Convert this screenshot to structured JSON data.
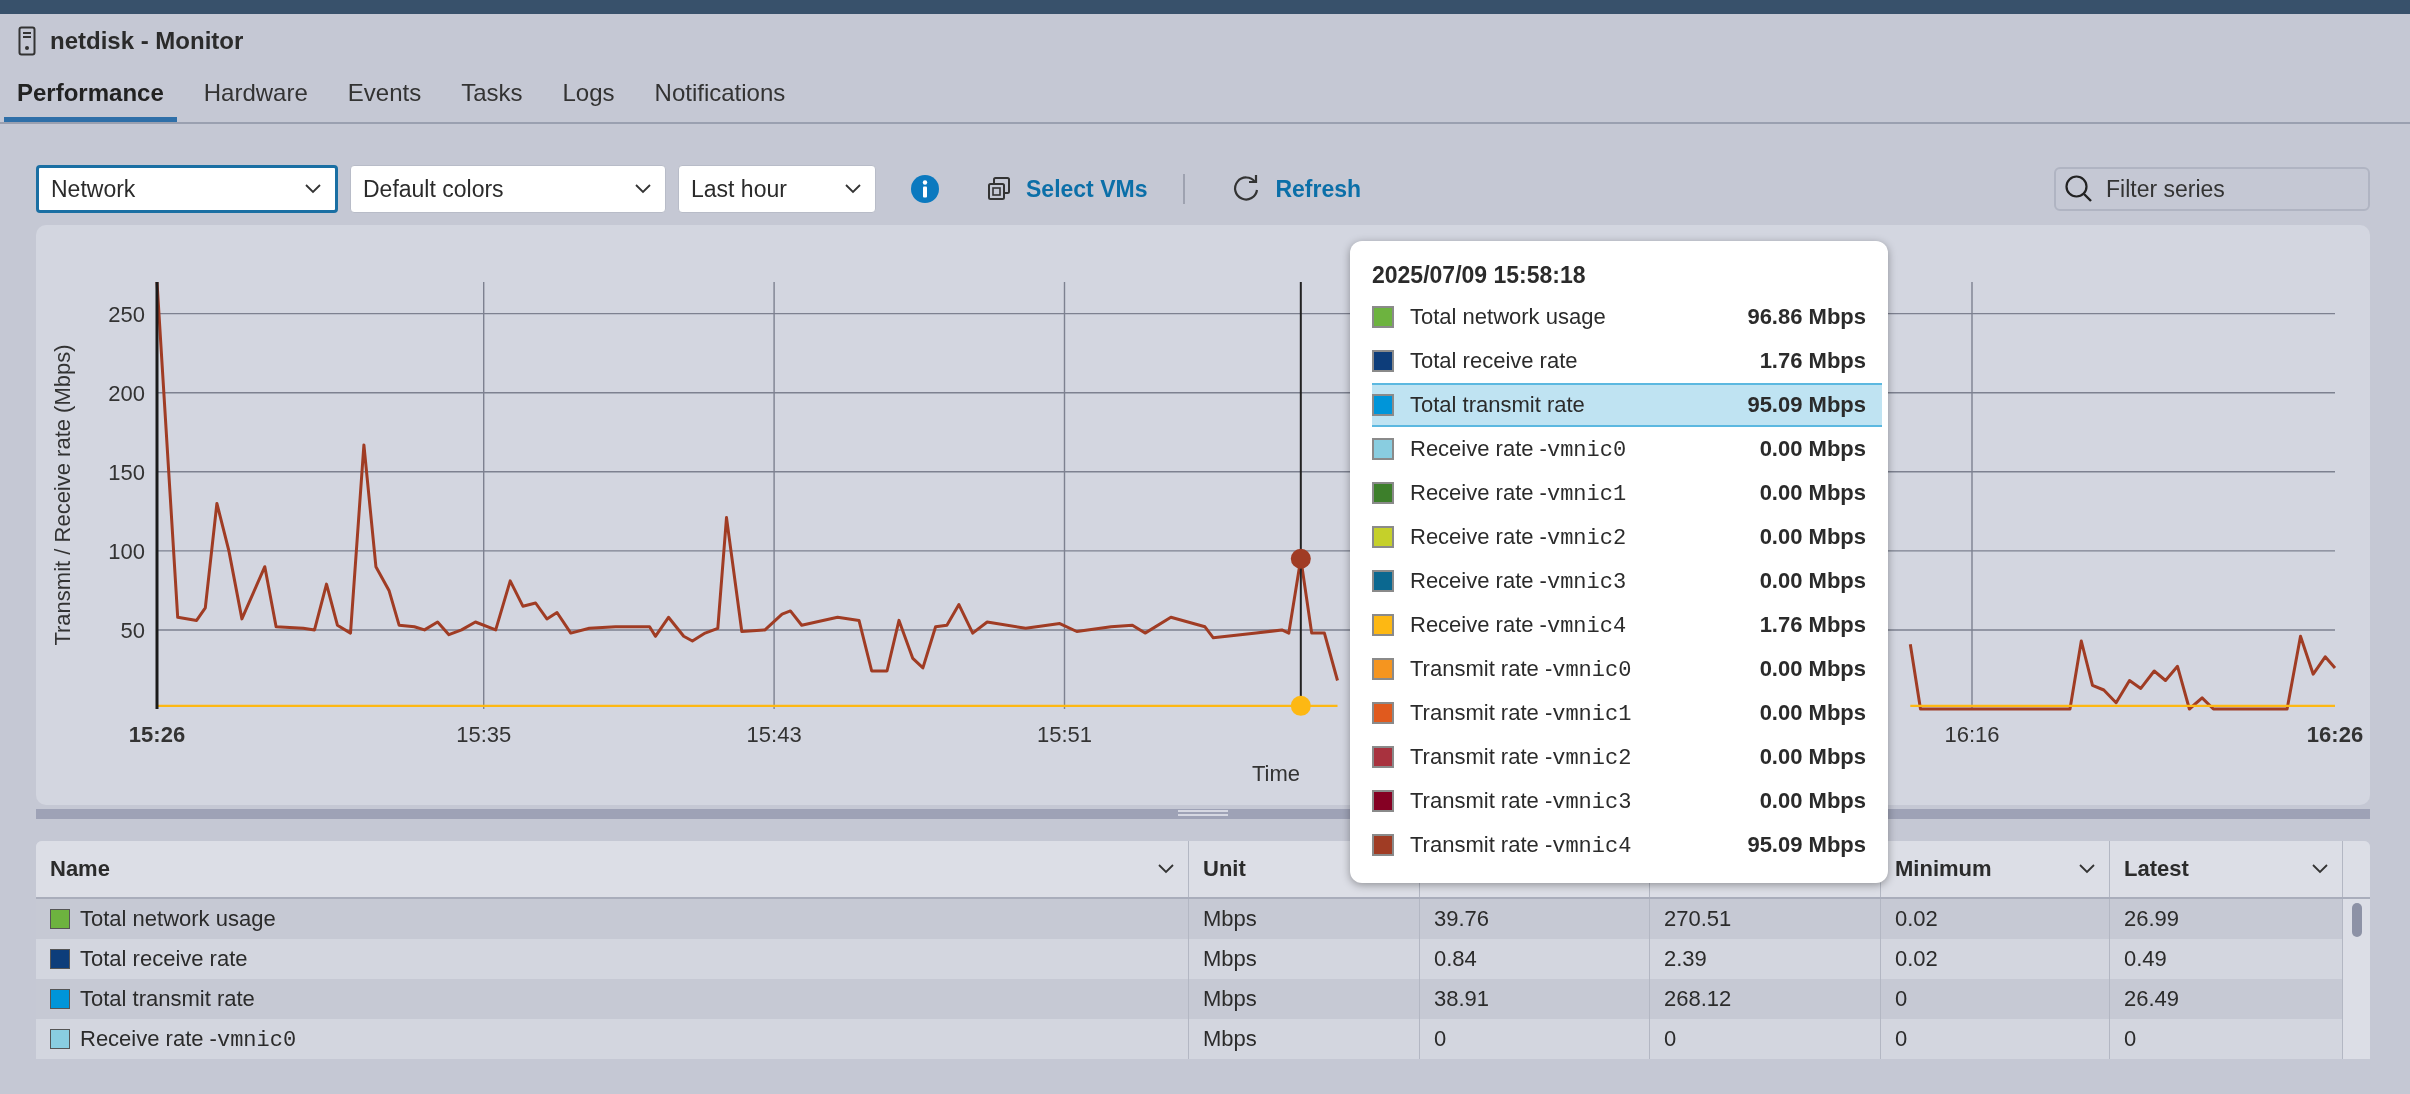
{
  "window": {
    "title": "netdisk - Monitor"
  },
  "tabs": [
    {
      "label": "Performance",
      "selected": true
    },
    {
      "label": "Hardware",
      "selected": false
    },
    {
      "label": "Events",
      "selected": false
    },
    {
      "label": "Tasks",
      "selected": false
    },
    {
      "label": "Logs",
      "selected": false
    },
    {
      "label": "Notifications",
      "selected": false
    }
  ],
  "toolbar": {
    "dropdowns": [
      {
        "value": "Network",
        "focused": true
      },
      {
        "value": "Default colors",
        "focused": false
      },
      {
        "value": "Last hour",
        "focused": false
      }
    ],
    "select_vms": "Select VMs",
    "refresh": "Refresh",
    "filter": {
      "placeholder": "Filter series"
    }
  },
  "chart": {
    "chart_data": {
      "type": "line",
      "xlabel": "Time",
      "ylabel": "Transmit / Receive rate (Mbps)",
      "xlim": [
        926,
        986
      ],
      "ylim": [
        0,
        270
      ],
      "grid": true,
      "yticks": [
        50,
        100,
        150,
        200,
        250
      ],
      "xticks": [
        {
          "value": 926,
          "label": "15:26"
        },
        {
          "value": 935,
          "label": "15:35"
        },
        {
          "value": 943,
          "label": "15:43"
        },
        {
          "value": 951,
          "label": "15:51"
        },
        {
          "value": 976,
          "label": "16:16"
        },
        {
          "value": 986,
          "label": "16:26"
        }
      ],
      "x": [
        926,
        926.57,
        927.09,
        927.33,
        927.65,
        927.98,
        928.34,
        928.97,
        929.28,
        930.03,
        930.34,
        930.67,
        930.97,
        931.33,
        931.7,
        932.03,
        932.39,
        932.67,
        933.09,
        933.37,
        933.73,
        934.04,
        934.39,
        934.77,
        935.33,
        935.73,
        936.08,
        936.43,
        936.74,
        937.02,
        937.4,
        937.91,
        938.63,
        939.57,
        939.73,
        940.09,
        940.51,
        940.75,
        941.1,
        941.45,
        941.69,
        942.11,
        942.75,
        943.22,
        943.45,
        943.76,
        944.16,
        944.75,
        945.34,
        945.69,
        946.11,
        946.44,
        946.82,
        947.1,
        947.45,
        947.76,
        948.09,
        948.47,
        948.87,
        949.93,
        950.87,
        951.34,
        952.28,
        952.87,
        953.22,
        953.93,
        954.87,
        955.1,
        956.28,
        956.99,
        957.18,
        957.51,
        957.81,
        958.16,
        958.52,
        966,
        974.3,
        974.58,
        975.99,
        978.7,
        979.01,
        979.32,
        979.63,
        979.97,
        980.34,
        980.65,
        981.02,
        981.33,
        981.66,
        981.99,
        982.34,
        982.65,
        984.68,
        985.05,
        985.4,
        985.73,
        986
      ],
      "series": [
        {
          "color": "#a03c24",
          "values": [
            270,
            58,
            56,
            64,
            130,
            100,
            57,
            90,
            52,
            51,
            50,
            79,
            53,
            48,
            167,
            90,
            75,
            53,
            52,
            50,
            55,
            47,
            50,
            55,
            50,
            81,
            65,
            67,
            57,
            61,
            48,
            51,
            52,
            52,
            46,
            58,
            46,
            43,
            48,
            51,
            121,
            49,
            50,
            60,
            62,
            53,
            55,
            58,
            56,
            24,
            24,
            56,
            32,
            26,
            52,
            53,
            66,
            48,
            55,
            51,
            54,
            49,
            52,
            53,
            48,
            58,
            52,
            45,
            48,
            50,
            48,
            95,
            48,
            48,
            18,
            null,
            41,
            0,
            0,
            0,
            43,
            15,
            12,
            4,
            18,
            13,
            24,
            18,
            27,
            0,
            7,
            0,
            0,
            46,
            22,
            33,
            26
          ]
        },
        {
          "color": "#fdb813",
          "values": [
            2,
            2,
            2,
            2,
            2,
            2,
            2,
            2,
            2,
            2,
            2,
            2,
            2,
            2,
            2,
            2,
            2,
            2,
            2,
            2,
            2,
            2,
            2,
            2,
            2,
            2,
            2,
            2,
            2,
            2,
            2,
            2,
            2,
            2,
            2,
            2,
            2,
            2,
            2,
            2,
            2,
            2,
            2,
            2,
            2,
            2,
            2,
            2,
            2,
            2,
            2,
            2,
            2,
            2,
            2,
            2,
            2,
            2,
            2,
            2,
            2,
            2,
            2,
            2,
            2,
            2,
            2,
            2,
            2,
            2,
            2,
            2,
            2,
            2,
            2,
            null,
            2,
            2,
            2,
            2,
            2,
            2,
            2,
            2,
            2,
            2,
            2,
            2,
            2,
            2,
            2,
            2,
            2,
            2,
            2,
            2,
            2
          ]
        }
      ],
      "ref_lines": [
        {
          "axis": "x",
          "value": 957.51
        }
      ]
    }
  },
  "tooltip": {
    "title": "2025/07/09 15:58:18",
    "items": [
      {
        "label": "Total network usage",
        "value": "96.86 Mbps",
        "color": "#6db33f",
        "selected": false
      },
      {
        "label": "Total receive rate",
        "value": "1.76 Mbps",
        "color": "#0d3d7a",
        "selected": false
      },
      {
        "label": "Total transmit rate",
        "value": "95.09 Mbps",
        "color": "#0095d9",
        "selected": true
      },
      {
        "label": "Receive rate -",
        "nic": "vmnic0",
        "value": "0.00 Mbps",
        "color": "#89cde0",
        "selected": false
      },
      {
        "label": "Receive rate -",
        "nic": "vmnic1",
        "value": "0.00 Mbps",
        "color": "#3d7f2b",
        "selected": false
      },
      {
        "label": "Receive rate -",
        "nic": "vmnic2",
        "value": "0.00 Mbps",
        "color": "#c5d02a",
        "selected": false
      },
      {
        "label": "Receive rate -",
        "nic": "vmnic3",
        "value": "0.00 Mbps",
        "color": "#0b6890",
        "selected": false
      },
      {
        "label": "Receive rate -",
        "nic": "vmnic4",
        "value": "1.76 Mbps",
        "color": "#fdb813",
        "selected": false
      },
      {
        "label": "Transmit rate -",
        "nic": "vmnic0",
        "value": "0.00 Mbps",
        "color": "#f5951f",
        "selected": false
      },
      {
        "label": "Transmit rate -",
        "nic": "vmnic1",
        "value": "0.00 Mbps",
        "color": "#e05a1e",
        "selected": false
      },
      {
        "label": "Transmit rate -",
        "nic": "vmnic2",
        "value": "0.00 Mbps",
        "color": "#a8323e",
        "selected": false
      },
      {
        "label": "Transmit rate -",
        "nic": "vmnic3",
        "value": "0.00 Mbps",
        "color": "#850023",
        "selected": false
      },
      {
        "label": "Transmit rate -",
        "nic": "vmnic4",
        "value": "95.09 Mbps",
        "color": "#a03c24",
        "selected": false
      }
    ]
  },
  "table": {
    "columns": [
      {
        "label": "Name",
        "menu": true
      },
      {
        "label": "Unit",
        "menu": false
      },
      {
        "menu": false
      },
      {
        "menu": false
      },
      {
        "label": "Minimum",
        "menu": true
      },
      {
        "label": "Latest",
        "menu": true
      }
    ],
    "rows": [
      {
        "color": "#6db33f",
        "cells": [
          "Total network usage",
          "Mbps",
          "39.76",
          "270.51",
          "0.02",
          "26.99"
        ]
      },
      {
        "color": "#0d3d7a",
        "cells": [
          "Total receive rate",
          "Mbps",
          "0.84",
          "2.39",
          "0.02",
          "0.49"
        ]
      },
      {
        "color": "#0095d9",
        "cells": [
          "Total transmit rate",
          "Mbps",
          "38.91",
          "268.12",
          "0",
          "26.49"
        ]
      },
      {
        "color": "#89cde0",
        "nic": "vmnic0",
        "cells": [
          "Receive rate -",
          "Mbps",
          "0",
          "0",
          "0",
          "0"
        ]
      }
    ]
  }
}
